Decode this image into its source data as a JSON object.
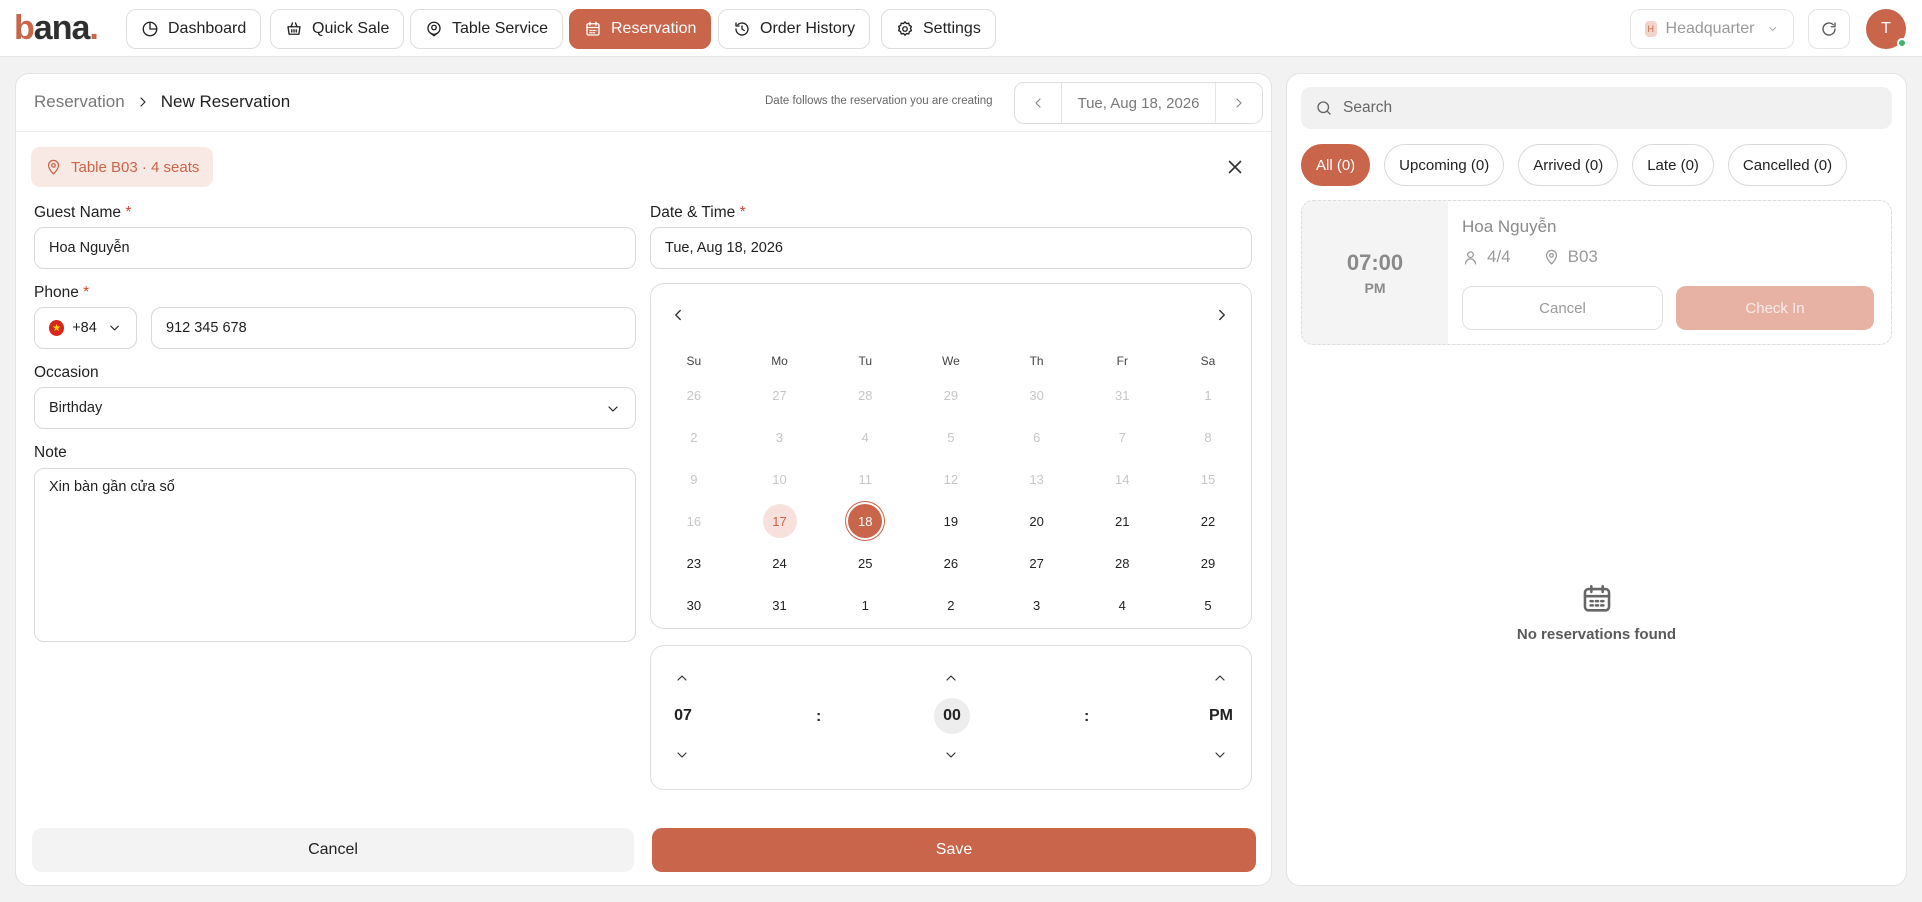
{
  "app": {
    "logo_prefix": "b",
    "logo_rest": "ana",
    "logo_dot": "."
  },
  "nav": {
    "items": [
      {
        "label": "Dashboard",
        "icon": "clock-pie-icon",
        "active": false
      },
      {
        "label": "Quick Sale",
        "icon": "basket-icon",
        "active": false
      },
      {
        "label": "Table Service",
        "icon": "table-pin-icon",
        "active": false
      },
      {
        "label": "Reservation",
        "icon": "calendar-icon",
        "active": true
      },
      {
        "label": "Order History",
        "icon": "history-icon",
        "active": false
      },
      {
        "label": "Settings",
        "icon": "gear-icon",
        "active": false
      }
    ],
    "branch": {
      "badge": "H",
      "label": "Headquarter"
    },
    "user_initial": "T"
  },
  "breadcrumb": {
    "root": "Reservation",
    "current": "New Reservation"
  },
  "date_hint": "Date follows the reservation you are creating",
  "header_date": "Tue, Aug 18, 2026",
  "table_chip": "Table B03 · 4 seats",
  "form": {
    "guest_name_label": "Guest Name",
    "guest_name": "Hoa Nguyễn",
    "phone_label": "Phone",
    "country_code": "+84",
    "phone": "912 345 678",
    "occasion_label": "Occasion",
    "occasion": "Birthday",
    "note_label": "Note",
    "note": "Xin bàn gần cửa sổ",
    "datetime_label": "Date & Time",
    "datetime_value": "Tue, Aug 18, 2026",
    "required_mark": "*"
  },
  "calendar": {
    "weekdays": [
      "Su",
      "Mo",
      "Tu",
      "We",
      "Th",
      "Fr",
      "Sa"
    ],
    "weeks": [
      [
        {
          "d": "26",
          "m": true
        },
        {
          "d": "27",
          "m": true
        },
        {
          "d": "28",
          "m": true
        },
        {
          "d": "29",
          "m": true
        },
        {
          "d": "30",
          "m": true
        },
        {
          "d": "31",
          "m": true
        },
        {
          "d": "1",
          "m": true
        }
      ],
      [
        {
          "d": "2",
          "m": true
        },
        {
          "d": "3",
          "m": true
        },
        {
          "d": "4",
          "m": true
        },
        {
          "d": "5",
          "m": true
        },
        {
          "d": "6",
          "m": true
        },
        {
          "d": "7",
          "m": true
        },
        {
          "d": "8",
          "m": true
        }
      ],
      [
        {
          "d": "9",
          "m": true
        },
        {
          "d": "10",
          "m": true
        },
        {
          "d": "11",
          "m": true
        },
        {
          "d": "12",
          "m": true
        },
        {
          "d": "13",
          "m": true
        },
        {
          "d": "14",
          "m": true
        },
        {
          "d": "15",
          "m": true
        }
      ],
      [
        {
          "d": "16",
          "m": true
        },
        {
          "d": "17",
          "today": true
        },
        {
          "d": "18",
          "sel": true
        },
        {
          "d": "19"
        },
        {
          "d": "20"
        },
        {
          "d": "21"
        },
        {
          "d": "22"
        }
      ],
      [
        {
          "d": "23"
        },
        {
          "d": "24"
        },
        {
          "d": "25"
        },
        {
          "d": "26"
        },
        {
          "d": "27"
        },
        {
          "d": "28"
        },
        {
          "d": "29"
        }
      ],
      [
        {
          "d": "30"
        },
        {
          "d": "31"
        },
        {
          "d": "1"
        },
        {
          "d": "2"
        },
        {
          "d": "3"
        },
        {
          "d": "4"
        },
        {
          "d": "5"
        }
      ]
    ]
  },
  "time": {
    "hour": "07",
    "minute": "00",
    "period": "PM",
    "separator": ":"
  },
  "actions": {
    "cancel": "Cancel",
    "save": "Save"
  },
  "right": {
    "search_placeholder": "Search",
    "filters": [
      {
        "label": "All (0)",
        "active": true
      },
      {
        "label": "Upcoming (0)",
        "active": false
      },
      {
        "label": "Arrived (0)",
        "active": false
      },
      {
        "label": "Late (0)",
        "active": false
      },
      {
        "label": "Cancelled (0)",
        "active": false
      }
    ],
    "preview": {
      "time": "07:00",
      "period": "PM",
      "name": "Hoa Nguyễn",
      "guests": "4/4",
      "table": "B03",
      "cancel_label": "Cancel",
      "checkin_label": "Check In"
    },
    "empty_message": "No reservations found"
  },
  "colors": {
    "accent": "#c9654a",
    "accent_soft": "#f9e9e5",
    "checkin_disabled": "#e7b1a3",
    "online": "#3fb56b"
  }
}
